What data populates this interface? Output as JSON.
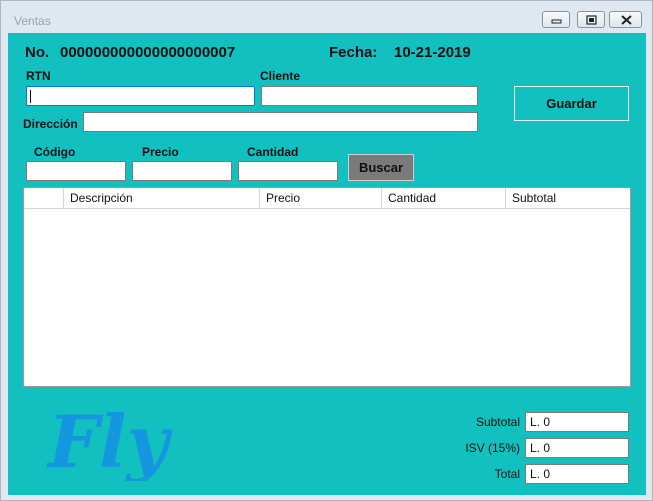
{
  "window": {
    "title": "Ventas"
  },
  "header": {
    "no_label": "No.",
    "no_value": "000000000000000000007",
    "fecha_label": "Fecha:",
    "fecha_value": "10-21-2019"
  },
  "form": {
    "rtn_label": "RTN",
    "rtn_value": "",
    "cliente_label": "Cliente",
    "cliente_value": "",
    "direccion_label": "Dirección",
    "direccion_value": "",
    "guardar_label": "Guardar"
  },
  "search": {
    "codigo_label": "Código",
    "precio_label": "Precio",
    "cantidad_label": "Cantidad",
    "codigo_value": "",
    "precio_value": "",
    "cantidad_value": "",
    "buscar_label": "Buscar"
  },
  "grid": {
    "columns": [
      "",
      "Descripción",
      "Precio",
      "Cantidad",
      "Subtotal"
    ],
    "rows": []
  },
  "logo_text": "Fly",
  "totals": {
    "subtotal_label": "Subtotal",
    "subtotal_value": "L. 0",
    "isv_label": "ISV (15%)",
    "isv_value": "L. 0",
    "total_label": "Total",
    "total_value": "L. 0"
  },
  "colors": {
    "background": "#12c0c0",
    "logo": "#1597e0",
    "buscar": "#7a7a7a"
  },
  "icons": [
    "minimize-icon",
    "maximize-icon",
    "close-icon"
  ]
}
